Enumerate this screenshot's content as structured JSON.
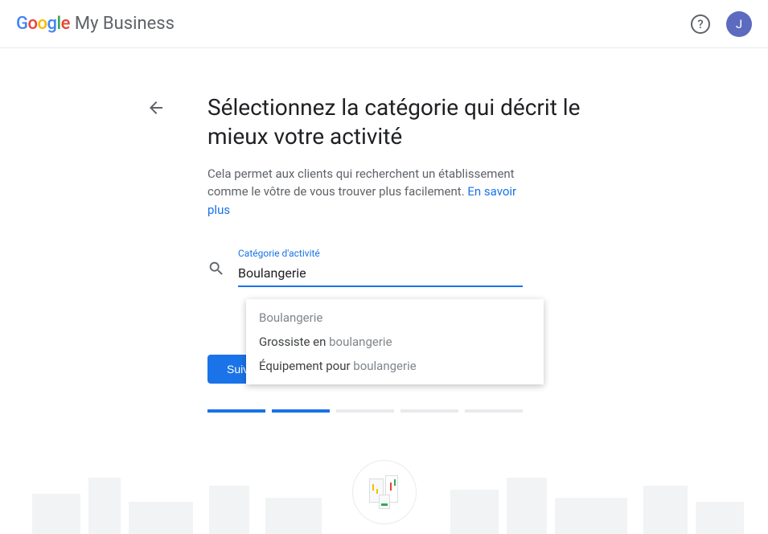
{
  "header": {
    "product_name": "My Business",
    "help_glyph": "?",
    "avatar_initial": "J"
  },
  "page": {
    "title": "Sélectionnez la catégorie qui décrit le mieux votre activité",
    "description_prefix": "Cela permet aux clients qui recherchent un établissement comme le vôtre de vous trouver plus facilement. ",
    "learn_more": "En savoir plus"
  },
  "field": {
    "label": "Catégorie d'activité",
    "value": "Boulangerie"
  },
  "dropdown": {
    "items": [
      {
        "prefix": "",
        "match": "Boulangerie",
        "suffix": ""
      },
      {
        "prefix": "Grossiste en ",
        "match": "boulangerie",
        "suffix": ""
      },
      {
        "prefix": "Équipement pour ",
        "match": "boulangerie",
        "suffix": ""
      }
    ]
  },
  "button": {
    "next": "Suivant"
  },
  "progress": {
    "total": 5,
    "done": 2
  }
}
